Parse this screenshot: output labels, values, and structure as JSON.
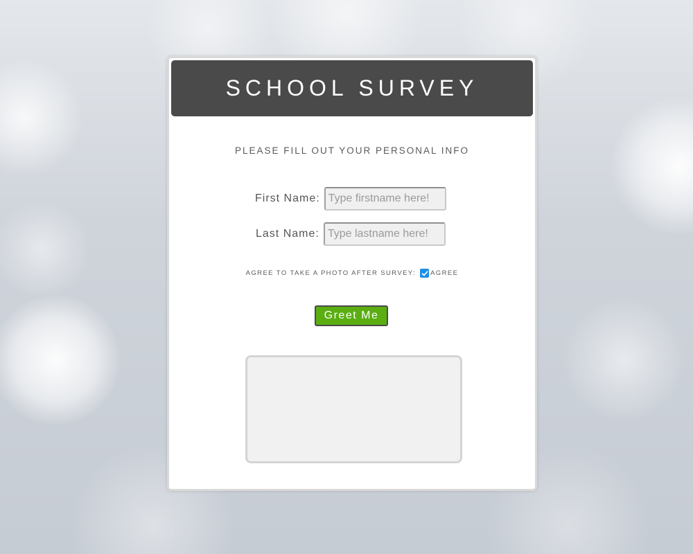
{
  "header": {
    "title": "SCHOOL SURVEY"
  },
  "form": {
    "subtitle": "PLEASE FILL OUT YOUR PERSONAL INFO",
    "first_name": {
      "label": "First Name:",
      "value": "",
      "placeholder": "Type firstname here!"
    },
    "last_name": {
      "label": "Last Name:",
      "value": "",
      "placeholder": "Type lastname here!"
    },
    "photo_consent": {
      "label": "AGREE TO TAKE A PHOTO AFTER SURVEY:",
      "checked": true,
      "checkbox_label": "AGREE"
    },
    "submit_label": "Greet Me",
    "output_text": ""
  },
  "colors": {
    "header_bg": "#4a4a4a",
    "button_bg": "#5aae12",
    "checkbox_bg": "#1e8ee6"
  },
  "icons": {
    "checkbox": "checkmark-icon"
  }
}
